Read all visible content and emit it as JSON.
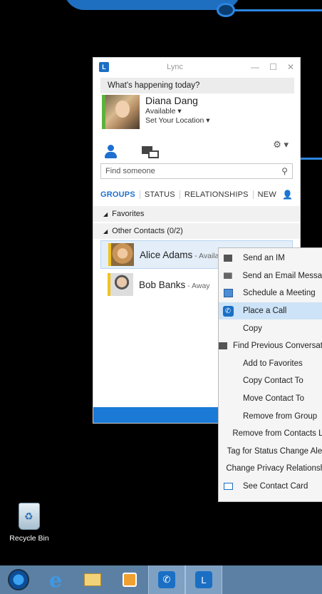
{
  "window": {
    "title": "Lync"
  },
  "whats_happening": "What's happening today?",
  "me": {
    "name": "Diana Dang",
    "status": "Available",
    "location": "Set Your Location"
  },
  "search": {
    "placeholder": "Find someone"
  },
  "tabs": [
    "GROUPS",
    "STATUS",
    "RELATIONSHIPS",
    "NEW"
  ],
  "groups": [
    {
      "label": "Favorites"
    },
    {
      "label": "Other Contacts (0/2)"
    }
  ],
  "contacts": [
    {
      "name": "Alice Adams",
      "status": " - Available"
    },
    {
      "name": "Bob Banks",
      "status": " - Away"
    }
  ],
  "context_menu": [
    "Send an IM",
    "Send an Email Message",
    "Schedule a Meeting",
    "Place a Call",
    "Copy",
    "Find Previous Conversations",
    "Add to Favorites",
    "Copy Contact To",
    "Move Contact To",
    "Remove from Group",
    "Remove from Contacts List",
    "Tag for Status Change Alerts",
    "Change Privacy Relationship",
    "See Contact Card"
  ],
  "desktop": {
    "recycle_bin": "Recycle Bin"
  },
  "colors": {
    "accent": "#1a7ad6",
    "available": "#5db23b",
    "away": "#f2c21b",
    "menu_highlight": "#cde3f7"
  }
}
